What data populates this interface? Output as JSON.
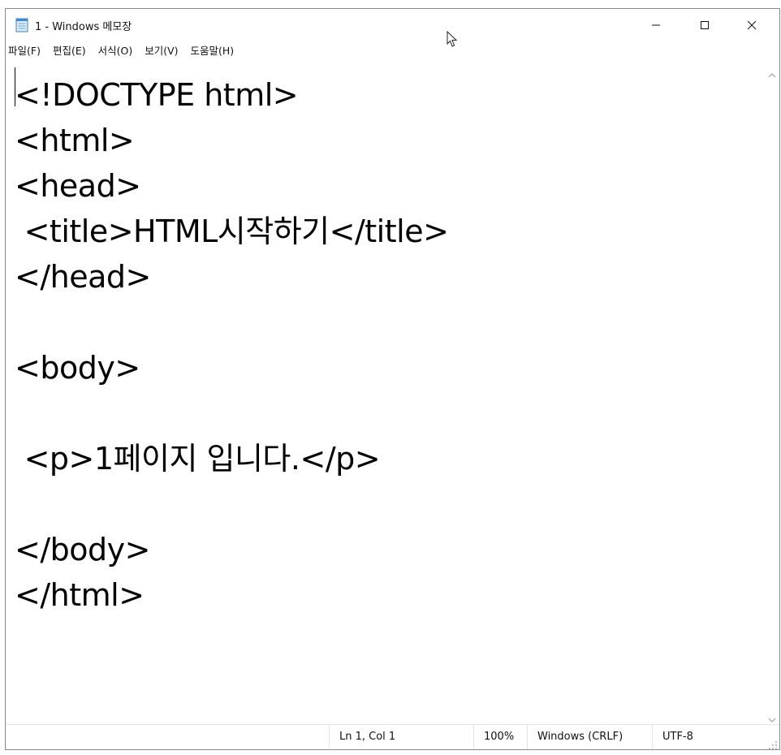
{
  "window": {
    "title": "1 - Windows 메모장"
  },
  "icons": {
    "app": "notepad-icon",
    "minimize": "minimize-icon",
    "maximize": "maximize-icon",
    "close": "close-icon",
    "cursor": "mouse-cursor-icon"
  },
  "menu": {
    "items": [
      {
        "label": "파일(F)"
      },
      {
        "label": "편집(E)"
      },
      {
        "label": "서식(O)"
      },
      {
        "label": "보기(V)"
      },
      {
        "label": "도움말(H)"
      }
    ]
  },
  "editor": {
    "lines": [
      "<!DOCTYPE html>",
      "<html>",
      "<head>",
      " <title>HTML시작하기</title>",
      "</head>",
      "",
      "<body>",
      "",
      " <p>1페이지 입니다.</p>",
      "",
      "</body>",
      "</html>"
    ]
  },
  "status": {
    "position": "Ln 1, Col 1",
    "zoom": "100%",
    "line_ending": "Windows (CRLF)",
    "encoding": "UTF-8"
  }
}
